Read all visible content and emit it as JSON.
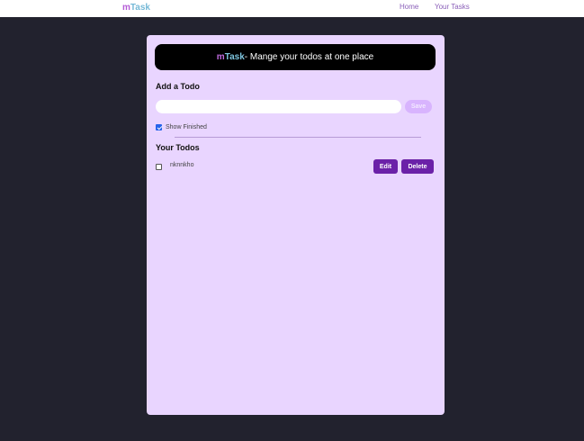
{
  "navbar": {
    "brand_m": "m",
    "brand_task": "Task",
    "links": [
      {
        "label": "Home"
      },
      {
        "label": "Your Tasks"
      }
    ]
  },
  "banner": {
    "m": "m",
    "task": "Task",
    "rest": "- Mange your todos at one place"
  },
  "add": {
    "heading": "Add a Todo",
    "input_value": "",
    "save_label": "Save"
  },
  "filter": {
    "show_finished_label": "Show Finished",
    "checked": true
  },
  "todos": {
    "heading": "Your Todos",
    "items": [
      {
        "text": "nknnkho",
        "done": false,
        "edit_label": "Edit",
        "delete_label": "Delete"
      }
    ]
  },
  "colors": {
    "background": "#22222e",
    "card": "#e9d5ff",
    "button": "#6b21a8",
    "save_button": "#d8b4fe",
    "brand_m": "#b45bd6",
    "brand_task": "#74b8d6"
  }
}
